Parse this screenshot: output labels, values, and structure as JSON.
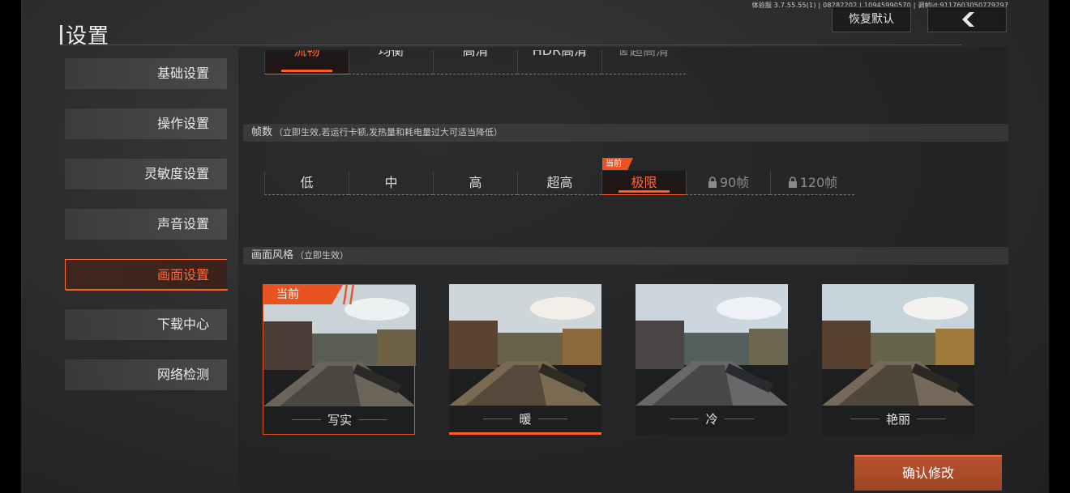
{
  "build_info": "体验服 3.7.55.55(1) | 08282202 | 10945990570 | 调帧id:9117603050779297",
  "page_title": "设置",
  "restore_label": "恢复默认",
  "back_icon": "chevron-left-icon",
  "sidebar": {
    "items": [
      {
        "label": "基础设置",
        "active": false
      },
      {
        "label": "操作设置",
        "active": false
      },
      {
        "label": "灵敏度设置",
        "active": false
      },
      {
        "label": "声音设置",
        "active": false
      },
      {
        "label": "画面设置",
        "active": true
      },
      {
        "label": "下载中心",
        "active": false
      },
      {
        "label": "网络检测",
        "active": false
      }
    ]
  },
  "quality": {
    "options": [
      {
        "label": "流畅",
        "selected": true
      },
      {
        "label": "均衡"
      },
      {
        "label": "高清"
      },
      {
        "label": "HDR高清"
      },
      {
        "label": "超高清",
        "locked": true
      }
    ]
  },
  "framerate": {
    "title": "帧数",
    "note": "（立即生效,若运行卡顿,发热量和耗电量过大可适当降低）",
    "current_tag": "当前",
    "options": [
      {
        "label": "低"
      },
      {
        "label": "中"
      },
      {
        "label": "高"
      },
      {
        "label": "超高"
      },
      {
        "label": "极限",
        "selected": true
      },
      {
        "label": "90帧",
        "locked": true
      },
      {
        "label": "120帧",
        "locked": true
      }
    ]
  },
  "style": {
    "title": "画面风格",
    "note": "（立即生效）",
    "current_tag": "当前",
    "cards": [
      {
        "label": "写实",
        "current": true,
        "tint": "#9aa3a7"
      },
      {
        "label": "暖",
        "selected": true,
        "tint": "#b08a5a"
      },
      {
        "label": "冷",
        "tint": "#8fa4b8"
      },
      {
        "label": "艳丽",
        "tint": "#b0925e"
      }
    ]
  },
  "confirm_label": "确认修改",
  "accent_color": "#ff5c28"
}
